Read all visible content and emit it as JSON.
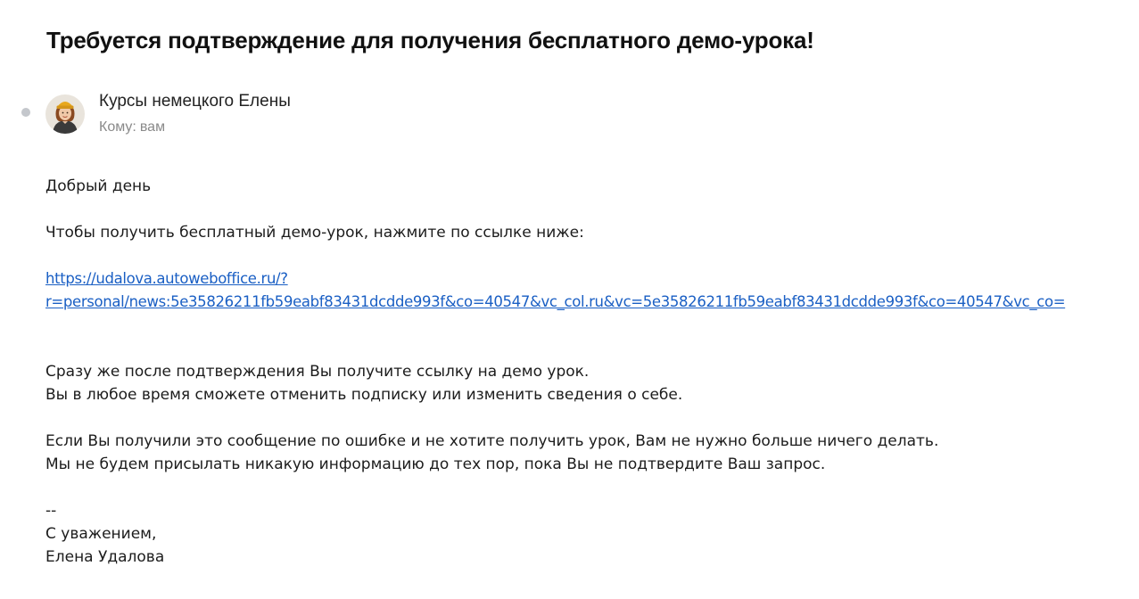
{
  "email": {
    "subject": "Требуется подтверждение для получения бесплатного демо-урока!",
    "sender": {
      "name": "Курсы немецкого Елены",
      "avatar_icon": "avatar-photo-icon",
      "unread_dot_color": "#c4c7cc"
    },
    "recipient": {
      "label": "Кому:",
      "value": "вам"
    },
    "body": {
      "greeting": "Добрый день",
      "instruction": "Чтобы получить бесплатный демо-урок, нажмите по ссылке ниже:",
      "link_line1": "https://udalova.autoweboffice.ru/?",
      "link_line2": "r=personal/news:5e35826211fb59eabf83431dcdde993f&co=40547&vc_col.ru&vc=5e35826211fb59eabf83431dcdde993f&co=40547&vc_co=",
      "after_confirm": "Сразу же после подтверждения Вы получите ссылку на демо урок.",
      "unsubscribe_note": "Вы в любое время сможете отменить подписку или изменить сведения о себе.",
      "mistake_note": "Если Вы получили это сообщение по ошибке и не хотите получить урок, Вам не нужно больше ничего делать.",
      "no_info_note": "Мы не будем присылать никакую информацию до тех пор, пока Вы не подтвердите Ваш запрос.",
      "signature_separator": "--",
      "closing": "С уважением,",
      "signature_name": "Елена Удалова"
    },
    "colors": {
      "link": "#1a5fc4",
      "muted": "#8a8a8a"
    }
  }
}
